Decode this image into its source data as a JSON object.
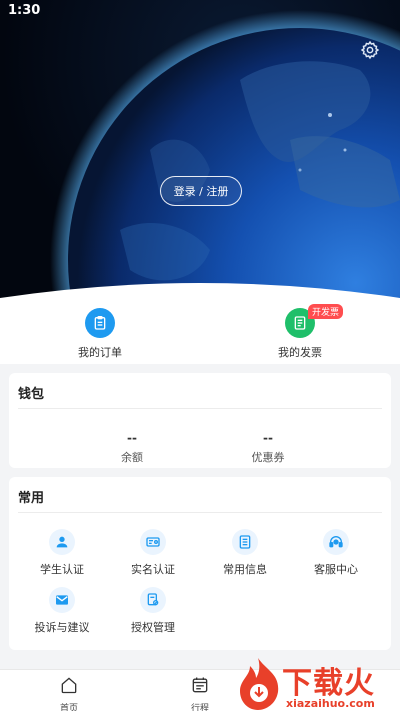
{
  "status_bar": {
    "time": "1:30"
  },
  "header": {
    "login_label": "登录 / 注册"
  },
  "quick_actions": [
    {
      "label": "我的订单",
      "icon": "clipboard-icon",
      "color": "#1e9af0"
    },
    {
      "label": "我的发票",
      "icon": "invoice-icon",
      "color": "#1fbf6a",
      "badge": "开发票"
    }
  ],
  "wallet": {
    "title": "钱包",
    "items": [
      {
        "value": "--",
        "label": "余额"
      },
      {
        "value": "--",
        "label": "优惠券"
      }
    ]
  },
  "common": {
    "title": "常用",
    "items": [
      {
        "label": "学生认证",
        "icon": "student-icon"
      },
      {
        "label": "实名认证",
        "icon": "id-card-icon"
      },
      {
        "label": "常用信息",
        "icon": "document-icon"
      },
      {
        "label": "客服中心",
        "icon": "headset-icon"
      },
      {
        "label": "投诉与建议",
        "icon": "mail-icon"
      },
      {
        "label": "授权管理",
        "icon": "authorization-icon"
      }
    ]
  },
  "tabbar": {
    "items": [
      {
        "label": "首页",
        "icon": "home-icon"
      },
      {
        "label": "行程",
        "icon": "calendar-icon"
      }
    ]
  },
  "watermark": {
    "text": "下载火",
    "url": "xiazaihuo.com"
  },
  "colors": {
    "primary": "#1e9af0",
    "green": "#1fbf6a",
    "badge": "#ff4d4f",
    "watermark": "#e8402a"
  }
}
